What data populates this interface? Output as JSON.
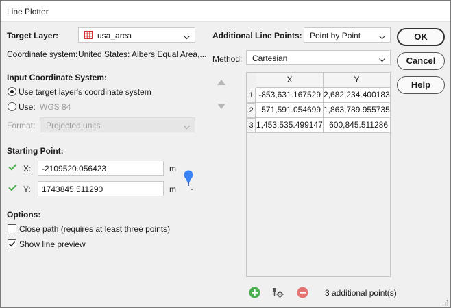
{
  "window": {
    "title": "Line Plotter"
  },
  "target_layer": {
    "label": "Target Layer:",
    "value": "usa_area",
    "coord_label": "Coordinate system:",
    "coord_value": "United States: Albers Equal Area,..."
  },
  "input_cs": {
    "heading": "Input Coordinate System:",
    "use_target_label": "Use target layer's coordinate system",
    "use_label": "Use:",
    "use_value": "WGS 84",
    "format_label": "Format:",
    "format_value": "Projected units"
  },
  "starting_point": {
    "heading": "Starting Point:",
    "x_label": "X:",
    "x_value": "-2109520.056423",
    "x_unit": "m",
    "y_label": "Y:",
    "y_value": "1743845.511290",
    "y_unit": "m"
  },
  "options": {
    "heading": "Options:",
    "close_path_label": "Close path (requires at least three points)",
    "close_path_checked": false,
    "show_preview_label": "Show line preview",
    "show_preview_checked": true
  },
  "additional": {
    "label": "Additional Line Points:",
    "value": "Point by Point",
    "method_label": "Method:",
    "method_value": "Cartesian"
  },
  "table": {
    "columns": [
      "X",
      "Y"
    ],
    "rows": [
      {
        "n": "1",
        "x": "-853,631.167529",
        "y": "2,682,234.400183"
      },
      {
        "n": "2",
        "x": "571,591.054699",
        "y": "1,863,789.955735"
      },
      {
        "n": "3",
        "x": "1,453,535.499147",
        "y": "600,845.511286"
      }
    ]
  },
  "footer": {
    "count_text": "3 additional point(s)"
  },
  "buttons": {
    "ok": "OK",
    "cancel": "Cancel",
    "help": "Help"
  },
  "colors": {
    "accent_green": "#4caf50",
    "remove_red": "#e57373",
    "pin_blue": "#3b82f6",
    "layer_icon_red": "#d32f2f"
  }
}
